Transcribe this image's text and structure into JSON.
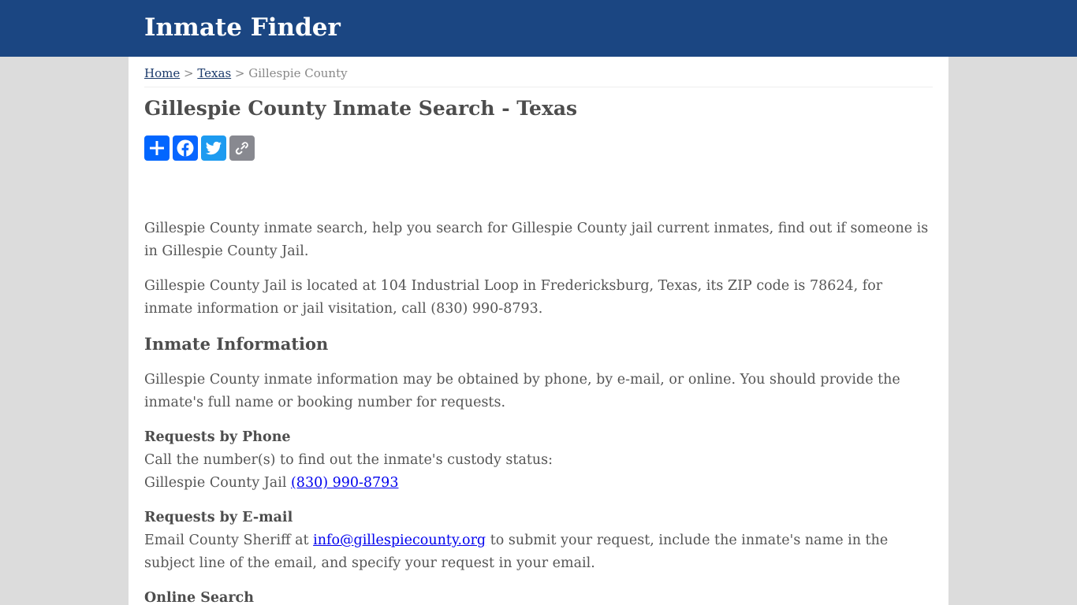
{
  "header": {
    "site_title": "Inmate Finder",
    "bg_color": "#1b4682"
  },
  "breadcrumb": {
    "home": "Home",
    "sep1": " > ",
    "state": "Texas",
    "sep2": " > ",
    "current": "Gillespie County"
  },
  "page_title": "Gillespie County Inmate Search - Texas",
  "share": [
    {
      "icon": "share-plus-icon",
      "color": "#0166ff"
    },
    {
      "icon": "facebook-icon",
      "color": "#0866ff"
    },
    {
      "icon": "twitter-icon",
      "color": "#1d9bf0"
    },
    {
      "icon": "copy-link-icon",
      "color": "#888990"
    }
  ],
  "intro": {
    "p1": "Gillespie County inmate search, help you search for Gillespie County jail current inmates, find out if someone is in Gillespie County Jail.",
    "p2": "Gillespie County Jail is located at 104 Industrial Loop in Fredericksburg, Texas, its ZIP code is 78624, for inmate information or jail visitation, call (830) 990-8793."
  },
  "inmate_info": {
    "heading": "Inmate Information",
    "text": "Gillespie County inmate information may be obtained by phone, by e-mail, or online. You should provide the inmate's full name or booking number for requests."
  },
  "phone": {
    "heading": "Requests by Phone",
    "line1": "Call the number(s) to find out the inmate's custody status:",
    "jail_label": "Gillespie County Jail ",
    "phone_link": "(830) 990-8793"
  },
  "email": {
    "heading": "Requests by E-mail",
    "prefix": "Email County Sheriff at ",
    "email_link": "info@gillespiecounty.org",
    "suffix": " to submit your request, include the inmate's name in the subject line of the email, and specify your request in your email."
  },
  "online": {
    "heading": "Online Search"
  }
}
